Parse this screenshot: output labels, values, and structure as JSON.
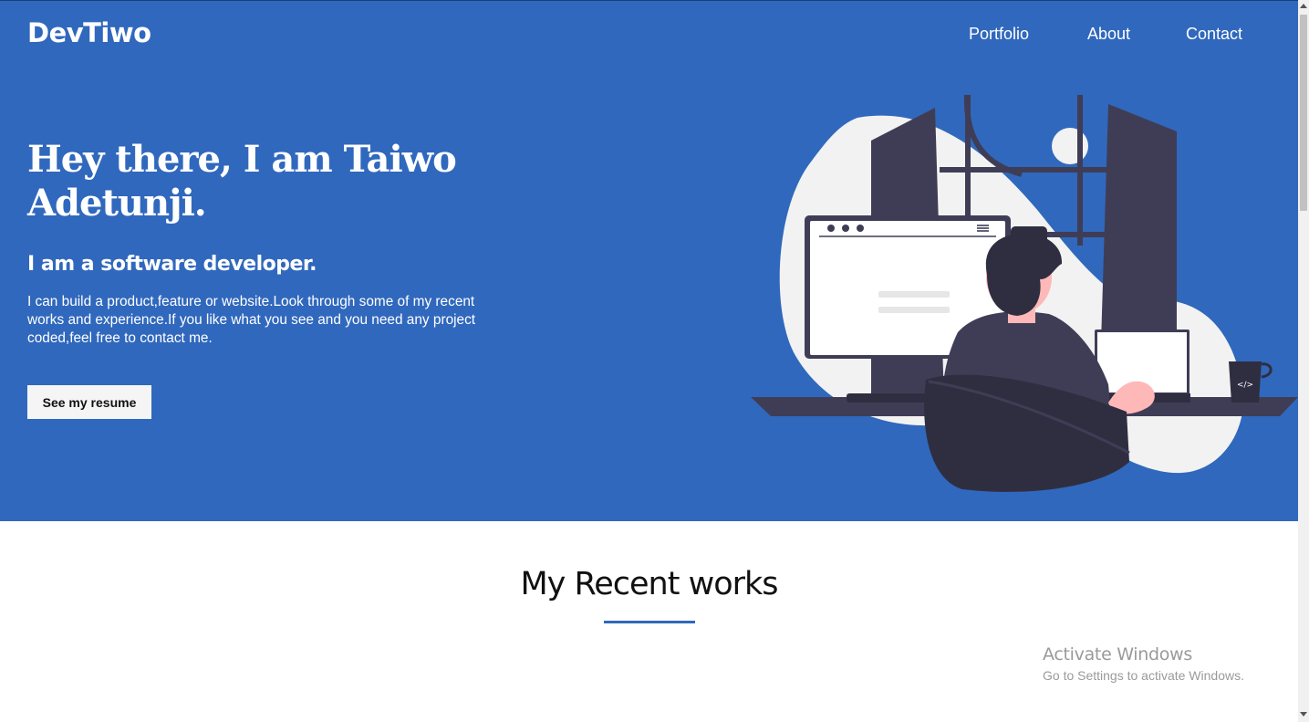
{
  "header": {
    "brand": "DevTiwo",
    "nav": [
      {
        "label": "Portfolio"
      },
      {
        "label": "About"
      },
      {
        "label": "Contact"
      }
    ]
  },
  "hero": {
    "title": "Hey there, I am Taiwo Adetunji.",
    "subtitle": "I am a software developer.",
    "description": "I can build a product,feature or website.Look through some of my recent works and experience.If you like what you see and you need any project coded,feel free to contact me.",
    "resume_button": "See my resume",
    "illustration": "developer-at-desk-illustration",
    "mug_label": "</>"
  },
  "works": {
    "title": "My Recent works"
  },
  "watermark": {
    "title": "Activate Windows",
    "subtitle": "Go to Settings to activate Windows."
  },
  "colors": {
    "primary": "#3068bd",
    "dark_figure": "#3f3d56",
    "light_shape": "#f2f2f2",
    "skin": "#ffb8b8"
  }
}
